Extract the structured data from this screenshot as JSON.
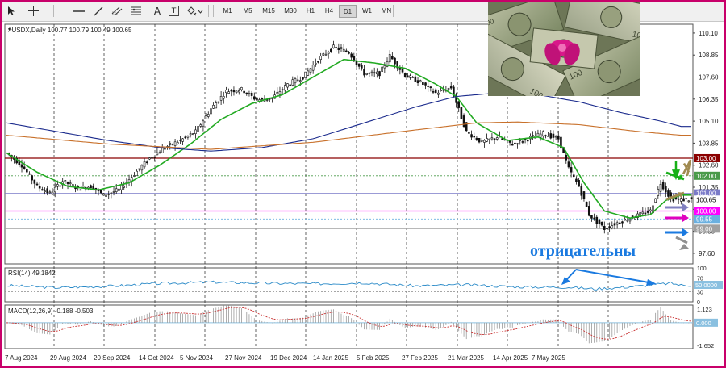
{
  "toolbar": {
    "tools": [
      "cursor-icon",
      "crosshair-icon",
      "hline-icon",
      "trendline-icon",
      "channel-icon",
      "fibo-icon",
      "text-icon",
      "label-icon",
      "shapes-icon"
    ],
    "text_tool": "A",
    "label_tool": "T",
    "timeframes": [
      "M1",
      "M5",
      "M15",
      "M30",
      "H1",
      "H4",
      "D1",
      "W1",
      "MN"
    ],
    "active_timeframe": "D1"
  },
  "chart_header": "#USDX,Daily  100.77 100.79 100.49 100.65",
  "annotation_text": "отрицательны",
  "colors": {
    "frame": "#c8006a",
    "price_line": "#22aa22",
    "ma_slow": "#1a2a8c",
    "ma_long": "#c8702a",
    "level_103": "#8b0000",
    "level_100": "#ff00ff",
    "rsi_line": "#2a8ac8",
    "macd_signal": "#c83030",
    "arrow_blue": "#1a7ae0"
  },
  "chart_data": [
    {
      "type": "candlestick",
      "title": "#USDX,Daily",
      "ohlc_last": {
        "open": 100.77,
        "high": 100.79,
        "low": 100.49,
        "close": 100.65
      },
      "x_labels": [
        "7 Aug 2024",
        "29 Aug 2024",
        "20 Sep 2024",
        "14 Oct 2024",
        "5 Nov 2024",
        "27 Nov 2024",
        "19 Dec 2024",
        "14 Jan 2025",
        "5 Feb 2025",
        "27 Feb 2025",
        "21 Mar 2025",
        "14 Apr 2025",
        "7 May 2025"
      ],
      "y_ticks": [
        "110.10",
        "108.85",
        "107.60",
        "106.35",
        "105.10",
        "103.85",
        "102.60",
        "101.35",
        "100.10",
        "98.85",
        "97.60"
      ],
      "ylim": [
        97.0,
        110.6
      ],
      "close_path": [
        [
          0,
          103.3
        ],
        [
          6,
          102.6
        ],
        [
          12,
          101.4
        ],
        [
          17,
          101.0
        ],
        [
          22,
          101.7
        ],
        [
          28,
          101.3
        ],
        [
          33,
          101.4
        ],
        [
          38,
          100.9
        ],
        [
          44,
          101.2
        ],
        [
          50,
          102.1
        ],
        [
          56,
          103.0
        ],
        [
          62,
          103.6
        ],
        [
          68,
          104.0
        ],
        [
          74,
          104.5
        ],
        [
          80,
          105.8
        ],
        [
          86,
          106.8
        ],
        [
          92,
          106.9
        ],
        [
          98,
          106.3
        ],
        [
          104,
          106.4
        ],
        [
          110,
          107.2
        ],
        [
          116,
          107.6
        ],
        [
          122,
          108.6
        ],
        [
          128,
          109.3
        ],
        [
          134,
          109.0
        ],
        [
          140,
          107.8
        ],
        [
          146,
          107.8
        ],
        [
          150,
          108.8
        ],
        [
          156,
          107.7
        ],
        [
          162,
          107.3
        ],
        [
          168,
          106.7
        ],
        [
          174,
          107.0
        ],
        [
          180,
          104.5
        ],
        [
          186,
          103.9
        ],
        [
          192,
          104.2
        ],
        [
          198,
          103.8
        ],
        [
          204,
          104.1
        ],
        [
          210,
          104.4
        ],
        [
          216,
          104.1
        ],
        [
          220,
          102.4
        ],
        [
          224,
          101.4
        ],
        [
          228,
          99.8
        ],
        [
          234,
          99.0
        ],
        [
          240,
          99.4
        ],
        [
          246,
          99.7
        ],
        [
          252,
          100.0
        ],
        [
          256,
          101.6
        ],
        [
          260,
          100.7
        ],
        [
          264,
          100.65
        ]
      ],
      "series": [
        {
          "name": "MA fast",
          "values": [
            [
              0,
              103.3
            ],
            [
              12,
              102.2
            ],
            [
              24,
              101.4
            ],
            [
              36,
              101.2
            ],
            [
              48,
              101.6
            ],
            [
              60,
              102.6
            ],
            [
              72,
              103.8
            ],
            [
              84,
              105.2
            ],
            [
              96,
              106.1
            ],
            [
              108,
              106.6
            ],
            [
              120,
              107.6
            ],
            [
              132,
              108.6
            ],
            [
              144,
              108.4
            ],
            [
              156,
              108.1
            ],
            [
              168,
              107.2
            ],
            [
              176,
              106.5
            ],
            [
              184,
              105.0
            ],
            [
              196,
              104.0
            ],
            [
              208,
              104.2
            ],
            [
              218,
              103.6
            ],
            [
              226,
              101.6
            ],
            [
              234,
              100.0
            ],
            [
              244,
              99.6
            ],
            [
              252,
              99.8
            ],
            [
              258,
              100.6
            ],
            [
              264,
              100.9
            ]
          ]
        },
        {
          "name": "MA slow",
          "values": [
            [
              0,
              105.0
            ],
            [
              20,
              104.5
            ],
            [
              40,
              104.0
            ],
            [
              60,
              103.6
            ],
            [
              80,
              103.4
            ],
            [
              100,
              103.6
            ],
            [
              120,
              104.1
            ],
            [
              140,
              105.0
            ],
            [
              160,
              105.9
            ],
            [
              176,
              106.5
            ],
            [
              192,
              106.7
            ],
            [
              208,
              106.6
            ],
            [
              224,
              106.2
            ],
            [
              240,
              105.6
            ],
            [
              256,
              105.1
            ],
            [
              264,
              104.8
            ]
          ]
        },
        {
          "name": "MA long",
          "values": [
            [
              0,
              104.3
            ],
            [
              40,
              103.8
            ],
            [
              80,
              103.5
            ],
            [
              120,
              103.9
            ],
            [
              160,
              104.6
            ],
            [
              184,
              105.0
            ],
            [
              200,
              105.05
            ],
            [
              224,
              104.9
            ],
            [
              248,
              104.5
            ],
            [
              264,
              104.3
            ]
          ]
        }
      ],
      "price_labels": [
        {
          "value": "103.00",
          "color": "#8b0000"
        },
        {
          "value": "102.00",
          "color": "#4a9a4a"
        },
        {
          "value": "101.00",
          "color": "#7a7ac8"
        },
        {
          "value": "100.65",
          "color": "#ffffff",
          "text_color": "#000000"
        },
        {
          "value": "100.00",
          "color": "#ff00ff"
        },
        {
          "value": "99.55",
          "color": "#6ab0e0"
        },
        {
          "value": "99.00",
          "color": "#a0a0a0"
        }
      ]
    },
    {
      "type": "line",
      "title": "RSI(14) 49.1842",
      "y_ticks": [
        "100",
        "70",
        "30",
        "0"
      ],
      "level_label": "50.0000",
      "ylim": [
        0,
        100
      ],
      "values": [
        [
          0,
          48
        ],
        [
          20,
          42
        ],
        [
          40,
          46
        ],
        [
          60,
          54
        ],
        [
          80,
          58
        ],
        [
          100,
          55
        ],
        [
          120,
          53
        ],
        [
          140,
          56
        ],
        [
          160,
          47
        ],
        [
          180,
          50
        ],
        [
          200,
          44
        ],
        [
          220,
          43
        ],
        [
          230,
          38
        ],
        [
          240,
          42
        ],
        [
          250,
          48
        ],
        [
          260,
          55
        ],
        [
          264,
          49
        ]
      ]
    },
    {
      "type": "bar",
      "title": "MACD(12,26,9) -0.188 -0.503",
      "y_ticks": [
        "1.123",
        "0.000",
        "-1.652"
      ],
      "ylim": [
        -1.652,
        1.123
      ]
    }
  ]
}
